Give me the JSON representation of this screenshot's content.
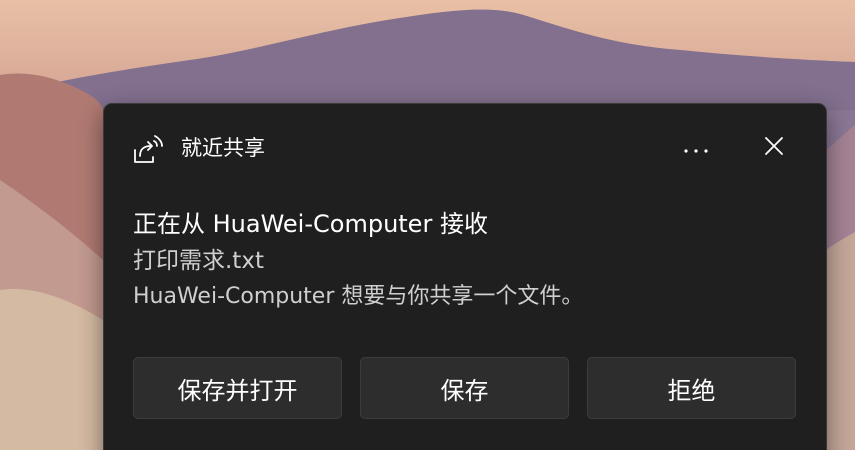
{
  "notification": {
    "app_name": "就近共享",
    "app_icon": "nearby-share-icon",
    "title": "正在从 HuaWei-Computer 接收",
    "filename": "打印需求.txt",
    "message": "HuaWei-Computer 想要与你共享一个文件。",
    "more_icon": "more-options-icon",
    "close_icon": "close-icon"
  },
  "actions": {
    "save_and_open": "保存并打开",
    "save": "保存",
    "decline": "拒绝"
  },
  "colors": {
    "toast_background": "#1f1f1f",
    "button_background": "#2d2d2d",
    "primary_text": "#ffffff",
    "secondary_text": "#cfcfcf"
  }
}
